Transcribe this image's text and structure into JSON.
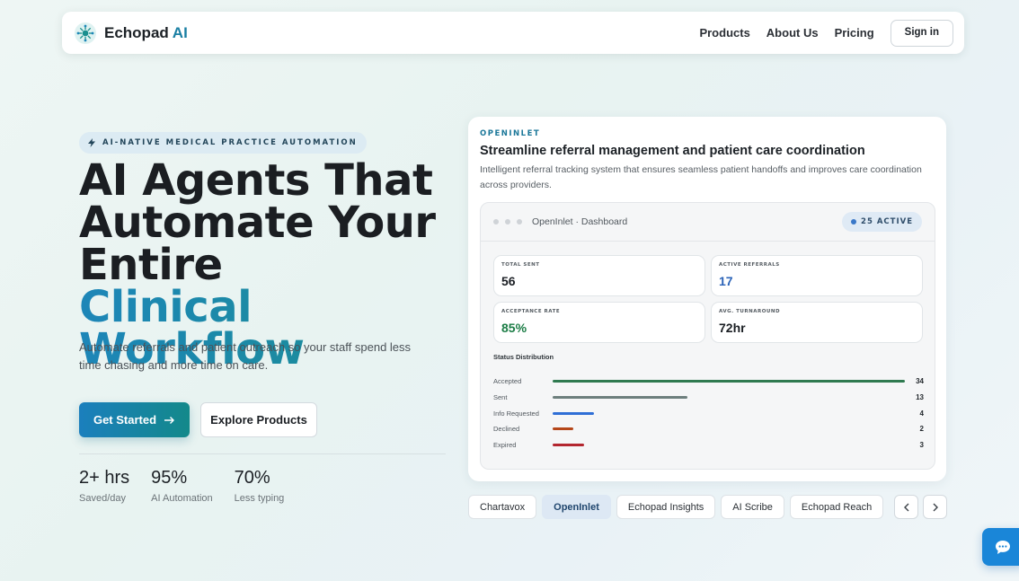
{
  "nav": {
    "brand_name": "Echopad",
    "brand_accent": "AI",
    "links": [
      "Products",
      "About Us",
      "Pricing"
    ],
    "signin_label": "Sign in"
  },
  "hero": {
    "badge": "AI-NATIVE MEDICAL PRACTICE AUTOMATION",
    "title_lines": [
      "AI Agents That",
      "Automate Your",
      "Entire"
    ],
    "title_accent": "Clinical Workflow",
    "subtitle": "Automate referrals and patient outreach so your staff spend less time chasing and more time on care.",
    "cta_primary": "Get Started",
    "cta_secondary": "Explore Products",
    "stats": [
      {
        "value": "2+ hrs",
        "label": "Saved/day"
      },
      {
        "value": "95%",
        "label": "AI Automation"
      },
      {
        "value": "70%",
        "label": "Less typing"
      }
    ]
  },
  "product_card": {
    "tag": "OPENINLET",
    "title": "Streamline referral management and patient care coordination",
    "description": "Intelligent referral tracking system that ensures seamless patient handoffs and improves care coordination across providers.",
    "dashboard": {
      "window_title": "OpenInlet · Dashboard",
      "active_badge": "25 ACTIVE",
      "metrics": [
        {
          "label": "TOTAL SENT",
          "value": "56",
          "color": "#1b1f24"
        },
        {
          "label": "ACTIVE REFERRALS",
          "value": "17",
          "color": "#2b63b8"
        },
        {
          "label": "ACCEPTANCE RATE",
          "value": "85%",
          "color": "#1c7d46"
        },
        {
          "label": "AVG. TURNAROUND",
          "value": "72hr",
          "color": "#1b1f24"
        }
      ],
      "status_title": "Status Distribution",
      "status_max": 34,
      "status": [
        {
          "label": "Accepted",
          "count": 34,
          "color": "#2f7a50"
        },
        {
          "label": "Sent",
          "count": 13,
          "color": "#6d7f7d"
        },
        {
          "label": "Info Requested",
          "count": 4,
          "color": "#2f6fd6"
        },
        {
          "label": "Declined",
          "count": 2,
          "color": "#b5471a"
        },
        {
          "label": "Expired",
          "count": 3,
          "color": "#b3262f"
        }
      ]
    }
  },
  "product_tabs": [
    "Chartavox",
    "OpenInlet",
    "Echopad Insights",
    "AI Scribe",
    "Echopad Reach"
  ],
  "active_tab": "OpenInlet",
  "colors": {
    "accent_blue": "#1a7fa3",
    "gradient_start": "#1d86b8",
    "gradient_end": "#1a8f8e",
    "chat_button": "#1a86d8"
  }
}
